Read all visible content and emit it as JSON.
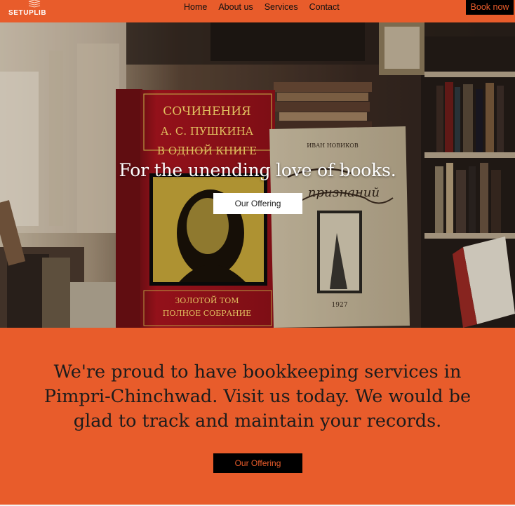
{
  "header": {
    "logo_text": "SETUPLIB",
    "nav": [
      "Home",
      "About us",
      "Services",
      "Contact"
    ],
    "cta_label": "Book now"
  },
  "hero": {
    "title": "For the unending love of books.",
    "button_label": "Our Offering",
    "book_red": {
      "line1": "СОЧИНЕНИЯ",
      "line2": "А. С. ПУШКИНА",
      "line3": "В ОДНОЙ КНИГЕ",
      "line4": "ЗОЛОТОЙ ТОМ",
      "line5": "ПОЛНОЕ СОБРАНИЕ"
    },
    "book_cream": {
      "author": "ИВАН НОВИКОВ",
      "title": "признаний",
      "year": "1927"
    }
  },
  "about": {
    "text": "We're proud to have bookkeeping services in Pimpri-Chinchwad. Visit us today. We would be glad to track and maintain your records.",
    "button_label": "Our Offering"
  },
  "colors": {
    "accent": "#e85c2b",
    "dark": "#000000"
  }
}
